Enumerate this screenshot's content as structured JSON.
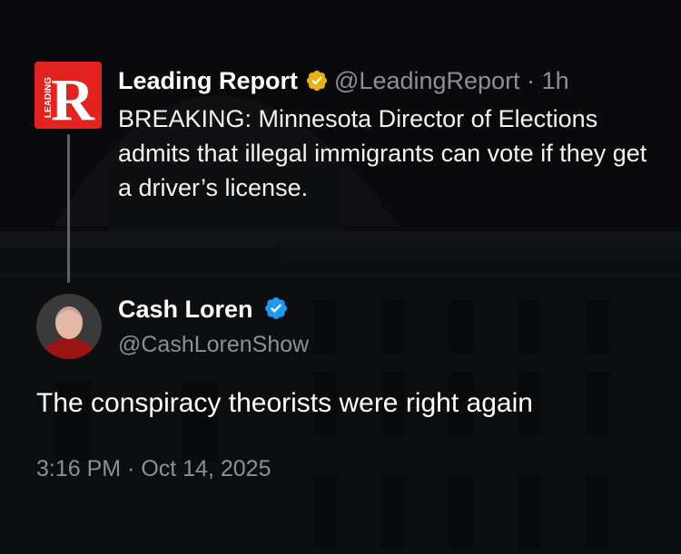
{
  "quoted_tweet": {
    "author_name": "Leading Report",
    "handle": "@LeadingReport",
    "separator": "·",
    "time_ago": "1h",
    "text": "BREAKING: Minnesota Director of Elections admits that illegal immigrants can vote if they get a driver’s license.",
    "logo_letter": "R",
    "logo_word": "LEADING",
    "badge_icon": "gold-verified-badge-icon",
    "logo_color": "#e3231f"
  },
  "main_tweet": {
    "author_name": "Cash Loren",
    "handle": "@CashLorenShow",
    "badge_icon": "blue-verified-badge-icon",
    "text": "The conspiracy theorists were right again",
    "timestamp": "3:16 PM · Oct 14, 2025"
  },
  "colors": {
    "background": "#0b0b0c",
    "gold_badge": "#e8b015",
    "blue_badge": "#1d9bf0",
    "muted_text": "#8b9096"
  }
}
